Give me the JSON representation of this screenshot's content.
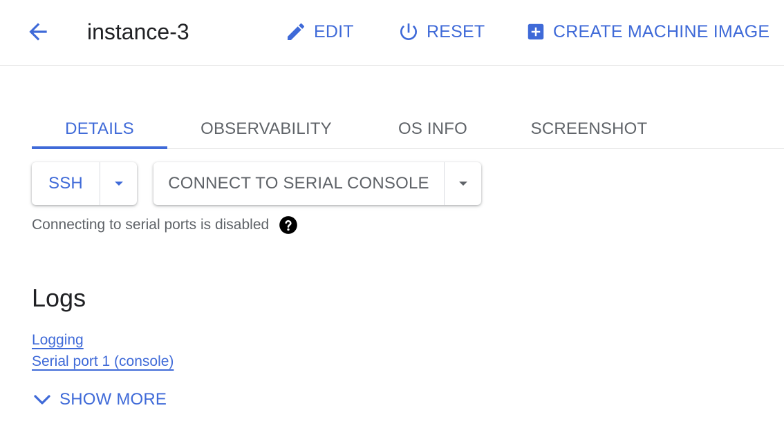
{
  "header": {
    "back_icon": "arrow-back-icon",
    "title": "instance-3",
    "actions": {
      "edit": "EDIT",
      "reset": "RESET",
      "create_image": "CREATE MACHINE IMAGE"
    }
  },
  "tabs": [
    {
      "label": "DETAILS",
      "active": true
    },
    {
      "label": "OBSERVABILITY",
      "active": false
    },
    {
      "label": "OS INFO",
      "active": false
    },
    {
      "label": "SCREENSHOT",
      "active": false
    }
  ],
  "connect": {
    "ssh_label": "SSH",
    "serial_label": "CONNECT TO SERIAL CONSOLE",
    "hint": "Connecting to serial ports is disabled"
  },
  "logs": {
    "title": "Logs",
    "links": [
      "Logging",
      "Serial port 1 (console)"
    ],
    "show_more": "SHOW MORE"
  },
  "colors": {
    "accent": "#3f6ad8",
    "muted": "#5f6368",
    "text": "#202124"
  }
}
